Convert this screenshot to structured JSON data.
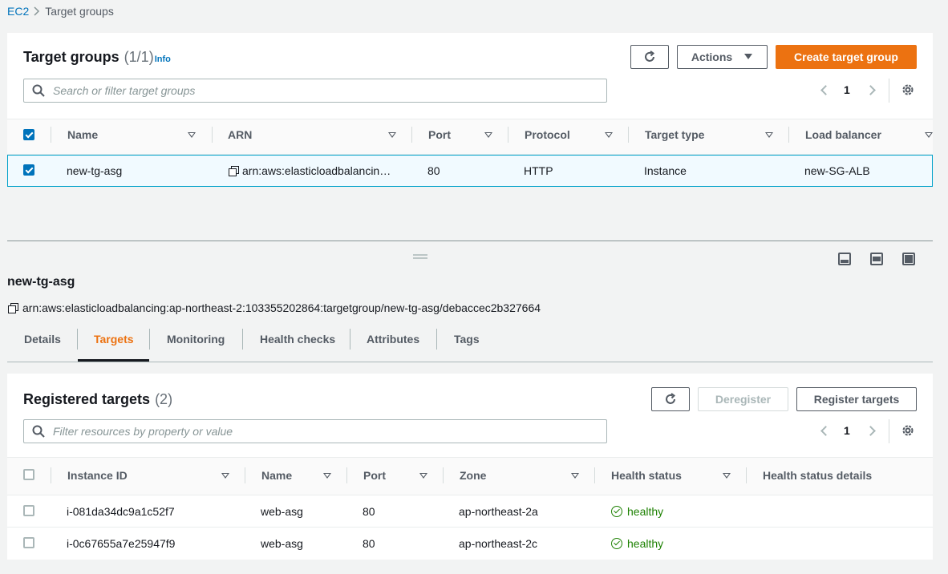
{
  "breadcrumb": {
    "root": "EC2",
    "current": "Target groups"
  },
  "target_groups": {
    "title": "Target groups",
    "count": "(1/1)",
    "info": "Info",
    "actions_label": "Actions",
    "create_label": "Create target group",
    "search_placeholder": "Search or filter target groups",
    "page": "1",
    "columns": [
      "Name",
      "ARN",
      "Port",
      "Protocol",
      "Target type",
      "Load balancer"
    ],
    "rows": [
      {
        "name": "new-tg-asg",
        "arn": "arn:aws:elasticloadbalancin…",
        "port": "80",
        "protocol": "HTTP",
        "target_type": "Instance",
        "load_balancer": "new-SG-ALB",
        "selected": true
      }
    ]
  },
  "detail": {
    "name": "new-tg-asg",
    "arn": "arn:aws:elasticloadbalancing:ap-northeast-2:103355202864:targetgroup/new-tg-asg/debaccec2b327664",
    "tabs": [
      "Details",
      "Targets",
      "Monitoring",
      "Health checks",
      "Attributes",
      "Tags"
    ],
    "active_tab": "Targets"
  },
  "registered": {
    "title": "Registered targets",
    "count": "(2)",
    "deregister_label": "Deregister",
    "register_label": "Register targets",
    "search_placeholder": "Filter resources by property or value",
    "page": "1",
    "columns": [
      "Instance ID",
      "Name",
      "Port",
      "Zone",
      "Health status",
      "Health status details"
    ],
    "rows": [
      {
        "instance_id": "i-081da34dc9a1c52f7",
        "name": "web-asg",
        "port": "80",
        "zone": "ap-northeast-2a",
        "health": "healthy"
      },
      {
        "instance_id": "i-0c67655a7e25947f9",
        "name": "web-asg",
        "port": "80",
        "zone": "ap-northeast-2c",
        "health": "healthy"
      }
    ]
  },
  "colors": {
    "accent": "#ec7211",
    "link": "#0073bb",
    "healthy": "#1d8102",
    "selected_row": "#f1faff"
  },
  "icons": [
    "chevron-right-icon",
    "refresh-icon",
    "caret-down-icon",
    "search-icon",
    "gear-icon",
    "copy-icon",
    "sort-icon",
    "status-ok-icon",
    "panel-bottom-icon",
    "panel-side-icon",
    "panel-full-icon",
    "drag-handle-icon"
  ]
}
